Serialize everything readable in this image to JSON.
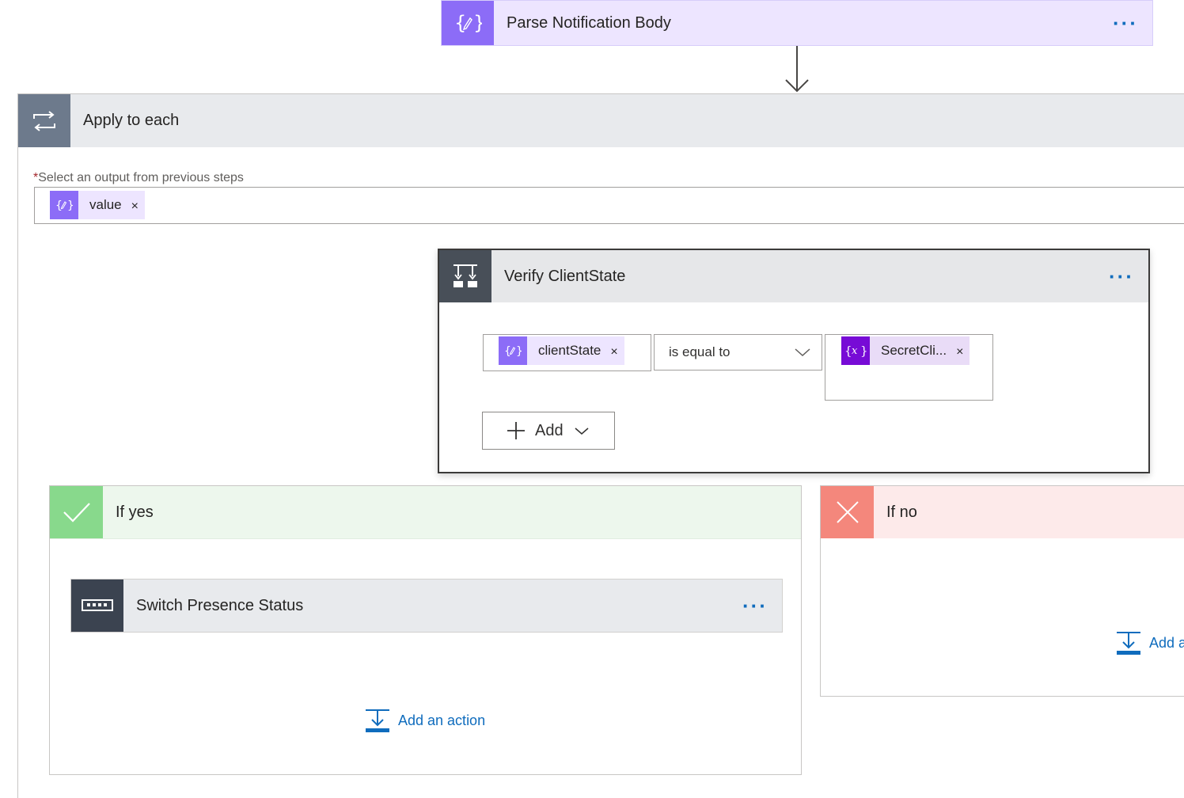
{
  "parse_card": {
    "title": "Parse Notification Body",
    "more_label": "···"
  },
  "apply_each": {
    "title": "Apply to each",
    "field_required_marker": "*",
    "field_label": "Select an output from previous steps",
    "token_label": "value",
    "token_remove": "×"
  },
  "condition": {
    "title": "Verify ClientState",
    "more_label": "···",
    "left_token": "clientState",
    "left_remove": "×",
    "operator": "is equal to",
    "right_token": "SecretCli...",
    "right_remove": "×",
    "add_label": "Add"
  },
  "if_yes": {
    "title": "If yes",
    "action": {
      "title": "Switch Presence Status",
      "more_label": "···"
    },
    "add_action_label": "Add an action"
  },
  "if_no": {
    "title": "If no",
    "add_action_label": "Add a"
  },
  "colors": {
    "parse_accent": "#8c6cf7",
    "parse_header_bg": "#ede5ff",
    "apply_accent": "#6d7a8c",
    "apply_header_bg": "#e8eaed",
    "condition_accent": "#484f58",
    "yes_accent": "#88d98c",
    "yes_header_bg": "#edf7ed",
    "no_accent": "#f4877c",
    "no_header_bg": "#fdeaea",
    "variable_accent": "#770bd6",
    "link": "#0f6cbd"
  },
  "icons": {
    "parse": "braces-pencil-icon",
    "apply": "loop-icon",
    "condition": "condition-icon",
    "yes": "checkmark-icon",
    "no": "close-icon",
    "action": "keyboard-icon",
    "variable": "variable-x-icon",
    "add": "plus-icon",
    "add_action": "add-action-icon",
    "dropdown": "chevron-down-icon"
  }
}
